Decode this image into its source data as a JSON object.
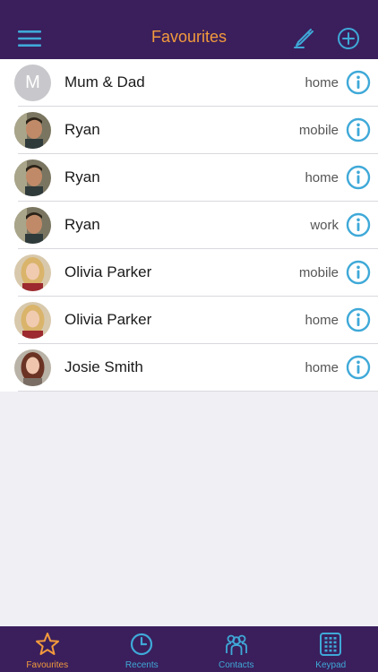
{
  "header": {
    "title": "Favourites",
    "menu_icon": "hamburger-menu-icon",
    "edit_icon": "pen-edit-icon",
    "add_icon": "plus-circle-icon"
  },
  "colors": {
    "bar_background": "#3a1f5c",
    "title_accent": "#f39a3c",
    "icon_accent": "#3fa9d8",
    "list_background": "#ffffff",
    "page_background": "#efeff4"
  },
  "favourites": [
    {
      "name": "Mum & Dad",
      "label": "home",
      "avatar_initial": "M",
      "avatar": "initial-placeholder"
    },
    {
      "name": "Ryan",
      "label": "mobile",
      "avatar": "man-dark-hair-photo"
    },
    {
      "name": "Ryan",
      "label": "home",
      "avatar": "man-dark-hair-photo"
    },
    {
      "name": "Ryan",
      "label": "work",
      "avatar": "man-dark-hair-photo"
    },
    {
      "name": "Olivia Parker",
      "label": "mobile",
      "avatar": "woman-blonde-photo"
    },
    {
      "name": "Olivia Parker",
      "label": "home",
      "avatar": "woman-blonde-photo"
    },
    {
      "name": "Josie Smith",
      "label": "home",
      "avatar": "woman-brown-hair-photo"
    }
  ],
  "tabbar": {
    "tabs": [
      {
        "label": "Favourites",
        "icon": "star-icon",
        "active": true
      },
      {
        "label": "Recents",
        "icon": "clock-icon",
        "active": false
      },
      {
        "label": "Contacts",
        "icon": "people-icon",
        "active": false
      },
      {
        "label": "Keypad",
        "icon": "keypad-grid-icon",
        "active": false
      }
    ]
  }
}
